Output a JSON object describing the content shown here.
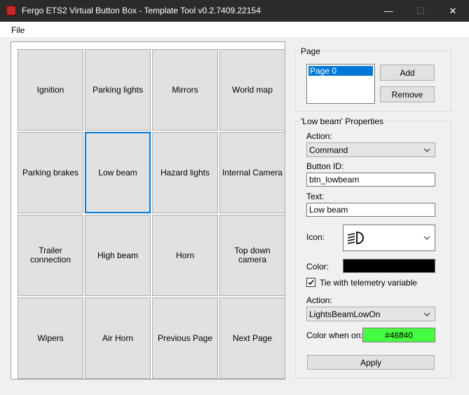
{
  "window": {
    "title": "Fergo ETS2 Virtual Button Box - Template Tool v0.2.7409.22154",
    "minimize_glyph": "—",
    "maximize_glyph": "☐",
    "close_glyph": "✕",
    "icon": "app-icon"
  },
  "menu": {
    "file": "File"
  },
  "grid": {
    "buttons": [
      "Ignition",
      "Parking lights",
      "Mirrors",
      "World map",
      "Parking brakes",
      "Low beam",
      "Hazard lights",
      "Internal Camera",
      "Trailer\nconnection",
      "High beam",
      "Horn",
      "Top down\ncamera",
      "Wipers",
      "Air Horn",
      "Previous Page",
      "Next Page"
    ],
    "selected": "Low beam"
  },
  "page_group": {
    "title": "Page",
    "items": [
      "Page 0"
    ],
    "add_label": "Add",
    "remove_label": "Remove"
  },
  "properties": {
    "title": "'Low beam' Properties",
    "action_label": "Action:",
    "action_value": "Command",
    "button_id_label": "Button ID:",
    "button_id_value": "btn_lowbeam",
    "text_label": "Text:",
    "text_value": "Low beam",
    "icon_label": "Icon:",
    "icon_name": "low-beam-headlight-icon",
    "color_label": "Color:",
    "color_value": "#000000",
    "tie_label": "Tie with telemetry variable",
    "tie_checked": true,
    "action2_label": "Action:",
    "action2_value": "LightsBeamLowOn",
    "color_on_label": "Color when on:",
    "color_on_value": "#46ff40",
    "apply_label": "Apply"
  },
  "colors": {
    "titlebar": "#2b2b2b",
    "selection": "#0078d7",
    "color_on": "#46ff40",
    "button_face": "#e1e1e1"
  }
}
